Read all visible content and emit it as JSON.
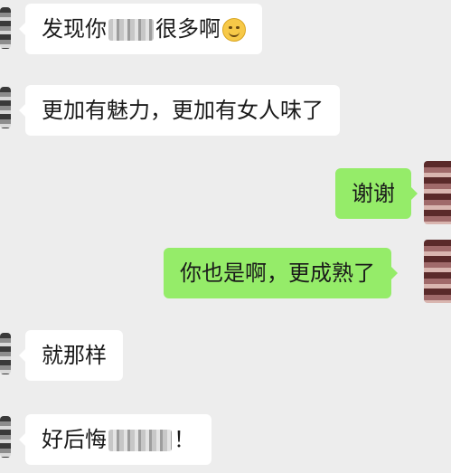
{
  "messages": [
    {
      "side": "in",
      "text_before": "发现你",
      "text_after": "很多啊",
      "emoji": "smiling-face-icon"
    },
    {
      "side": "in",
      "text": "更加有魅力，更加有女人味了"
    },
    {
      "side": "out",
      "text": "谢谢"
    },
    {
      "side": "out",
      "text": "你也是啊，更成熟了"
    },
    {
      "side": "in",
      "text": "就那样"
    },
    {
      "side": "in",
      "text_before": "好后悔",
      "text_after": "！"
    }
  ],
  "colors": {
    "background": "#ededed",
    "incoming_bubble": "#ffffff",
    "outgoing_bubble": "#95ec69"
  }
}
